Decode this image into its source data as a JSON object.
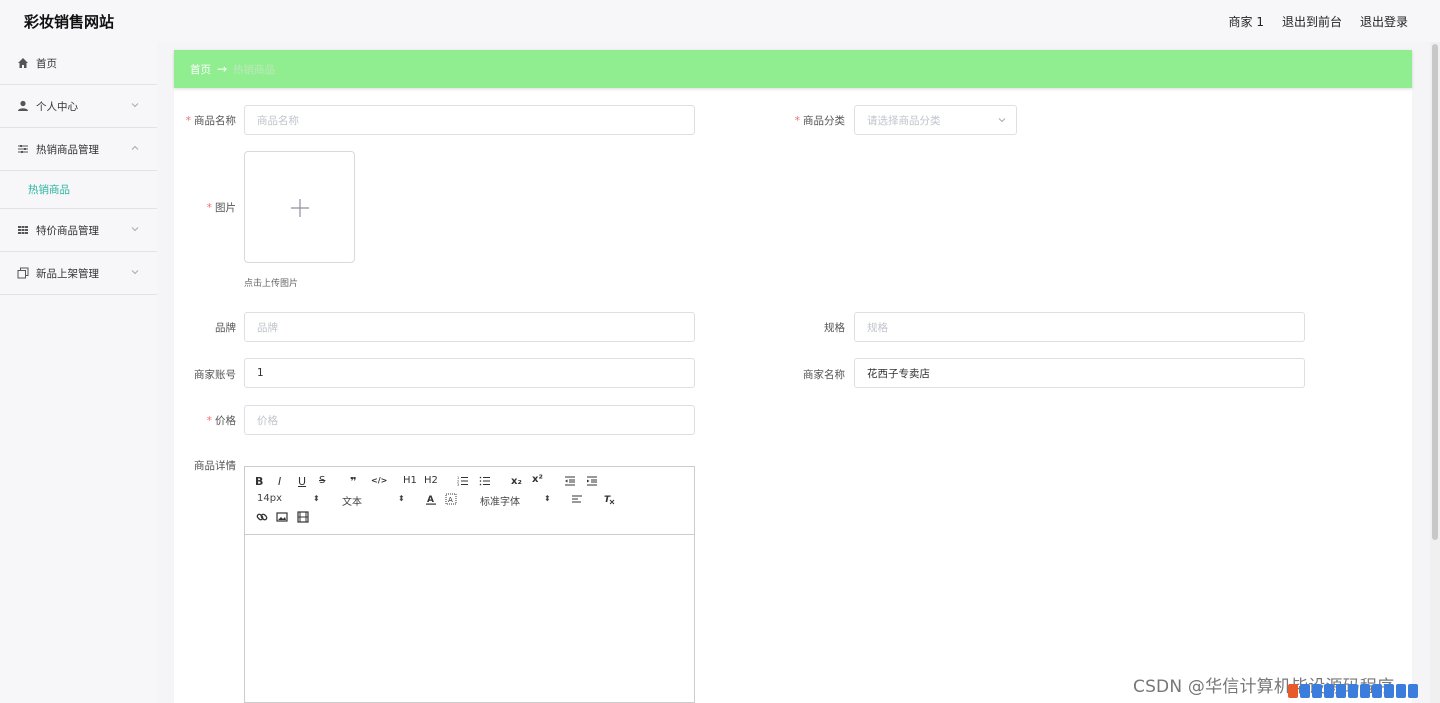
{
  "header": {
    "brand": "彩妆销售网站",
    "links": [
      "商家 1",
      "退出到前台",
      "退出登录"
    ]
  },
  "sidebar": {
    "items": [
      {
        "label": "首页",
        "icon": "home-icon"
      },
      {
        "label": "个人中心",
        "icon": "user-icon"
      },
      {
        "label": "热销商品管理",
        "icon": "sliders-icon"
      },
      {
        "label": "特价商品管理",
        "icon": "grid-icon"
      },
      {
        "label": "新品上架管理",
        "icon": "copy-icon"
      }
    ],
    "sub_item": "热销商品"
  },
  "breadcrumb": {
    "home": "首页",
    "arrow": "→",
    "current": "热销商品"
  },
  "form": {
    "name": {
      "label": "商品名称",
      "placeholder": "商品名称"
    },
    "category": {
      "label": "商品分类",
      "placeholder": "请选择商品分类"
    },
    "image": {
      "label": "图片",
      "hint": "点击上传图片"
    },
    "brand": {
      "label": "品牌",
      "placeholder": "品牌"
    },
    "spec": {
      "label": "规格",
      "placeholder": "规格"
    },
    "merchant_account": {
      "label": "商家账号",
      "value": "1"
    },
    "merchant_name": {
      "label": "商家名称",
      "value": "花西子专卖店"
    },
    "price": {
      "label": "价格",
      "placeholder": "价格"
    },
    "detail": {
      "label": "商品详情"
    }
  },
  "editor": {
    "row1": [
      "B",
      "I",
      "U",
      "S",
      "❞",
      "</>",
      "H1",
      "H2",
      "OL",
      "UL",
      "x₂",
      "x²",
      "outdent",
      "indent"
    ],
    "size": "14px",
    "header": "文本",
    "font": "标准字体"
  },
  "watermark": "CSDN @华信计算机毕设源码程序",
  "colors": {
    "accent": "#90ee90",
    "active_sub": "#2bb5a0",
    "required": "#f56c6c"
  }
}
